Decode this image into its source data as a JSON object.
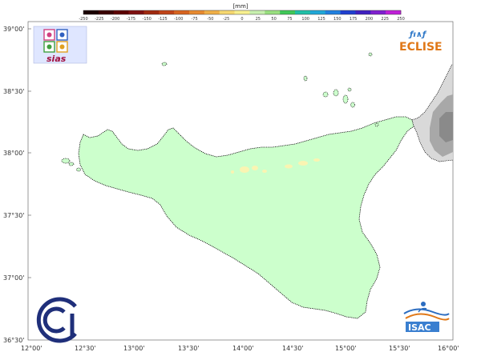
{
  "colorbar": {
    "unit": "[mm]",
    "ticks": [
      "-250",
      "-225",
      "-200",
      "-175",
      "-150",
      "-125",
      "-100",
      "-75",
      "-50",
      "-25",
      "0",
      "25",
      "50",
      "75",
      "100",
      "125",
      "150",
      "175",
      "200",
      "225",
      "250"
    ],
    "colors": [
      "#1a0000",
      "#3a0000",
      "#5c0000",
      "#7e1010",
      "#a02a10",
      "#c04418",
      "#d86420",
      "#e88a30",
      "#f0b048",
      "#f6d870",
      "#f8f090",
      "#c8f0b0",
      "#9ae080",
      "#40c858",
      "#20c0a8",
      "#20a8d8",
      "#2080e0",
      "#2040d0",
      "#4020c0",
      "#8020d0",
      "#c020d8"
    ]
  },
  "axes": {
    "lon_labels": [
      "12°00'",
      "12°30'",
      "13°00'",
      "13°30'",
      "14°00'",
      "14°30'",
      "15°00'",
      "15°30'",
      "16°00'"
    ],
    "lat_labels": [
      "39°00'",
      "38°30'",
      "38°00'",
      "37°30'",
      "37°00'",
      "36°30'"
    ]
  },
  "land_color": "#ccffcc",
  "logos": {
    "sias": "sias",
    "eclise_mark": "ƒı∧ƒ",
    "eclise": "ECLISE",
    "isac": "ISAC"
  }
}
